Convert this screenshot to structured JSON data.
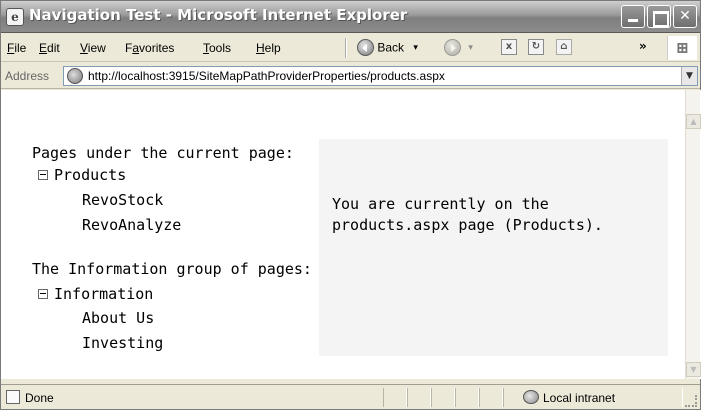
{
  "window": {
    "title": "Navigation Test - Microsoft Internet Explorer"
  },
  "menu": {
    "items": [
      {
        "key": "F",
        "rest": "ile"
      },
      {
        "key": "E",
        "rest": "dit"
      },
      {
        "key": "V",
        "rest": "iew"
      },
      {
        "pre": "F",
        "key": "a",
        "rest": "vorites"
      },
      {
        "key": "T",
        "rest": "ools"
      },
      {
        "key": "H",
        "rest": "elp"
      }
    ],
    "back_label": "Back",
    "back_dropdown": "▾",
    "forward_dropdown": "▾",
    "more": "»"
  },
  "address": {
    "label": "Address",
    "url": "http://localhost:3915/SiteMapPathProviderProperties/products.aspx"
  },
  "content": {
    "section1_heading": "Pages under the current page:",
    "section1_node": "Products",
    "section1_children": [
      "RevoStock",
      "RevoAnalyze"
    ],
    "section2_heading": "The Information group of pages:",
    "section2_node": "Information",
    "section2_children": [
      "About Us",
      "Investing"
    ],
    "info_line1": "You are currently on the",
    "info_line2": "products.aspx page (Products)."
  },
  "status": {
    "text": "Done",
    "zone": "Local intranet"
  },
  "icons": {
    "page": "ie-page-icon",
    "back": "back-arrow-icon",
    "forward": "forward-arrow-icon",
    "stop": "stop-icon",
    "refresh": "refresh-icon",
    "home": "home-icon",
    "windows_logo": "windows-logo-icon",
    "zone": "local-intranet-icon"
  }
}
